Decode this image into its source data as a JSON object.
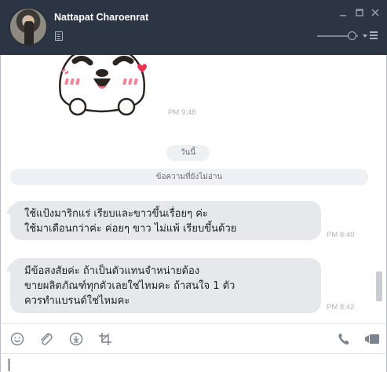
{
  "header": {
    "contact_name": "Nattapat Charoenrat",
    "background_color": "#2c3544"
  },
  "chat": {
    "sticker_time": "PM 9:48",
    "date_divider": "วันนี้",
    "unread_divider": "ข้อความที่ยังไม่อ่าน",
    "messages": [
      {
        "lines": [
          "ใช้แป้งมาริกแร่ เรียบและขาวขึ้นเรื่อยๆ ค่ะ",
          "ใช้มาเดือนกว่าค่ะ ค่อยๆ ขาว ไม่แพ้ เรียบขึ้นด้วย"
        ],
        "time": "PM 8:40"
      },
      {
        "lines": [
          "มีข้อสงสัยค่ะ ถ้าเป็นตัวแทนจำหน่ายต้อง",
          "ขายผลิตภัณฑ์ทุกตัวเลยใช่ไหมคะ ถ้าสนใจ 1 ตัว",
          "ควรทำแบรนด์ใช่ไหมคะ"
        ],
        "time": "PM 8:42"
      }
    ],
    "bubble_color": "#e6e8ec"
  },
  "toolbar": {
    "icons": [
      "emoji-icon",
      "attach-icon",
      "download-icon",
      "crop-icon",
      "phone-icon",
      "video-icon"
    ]
  }
}
